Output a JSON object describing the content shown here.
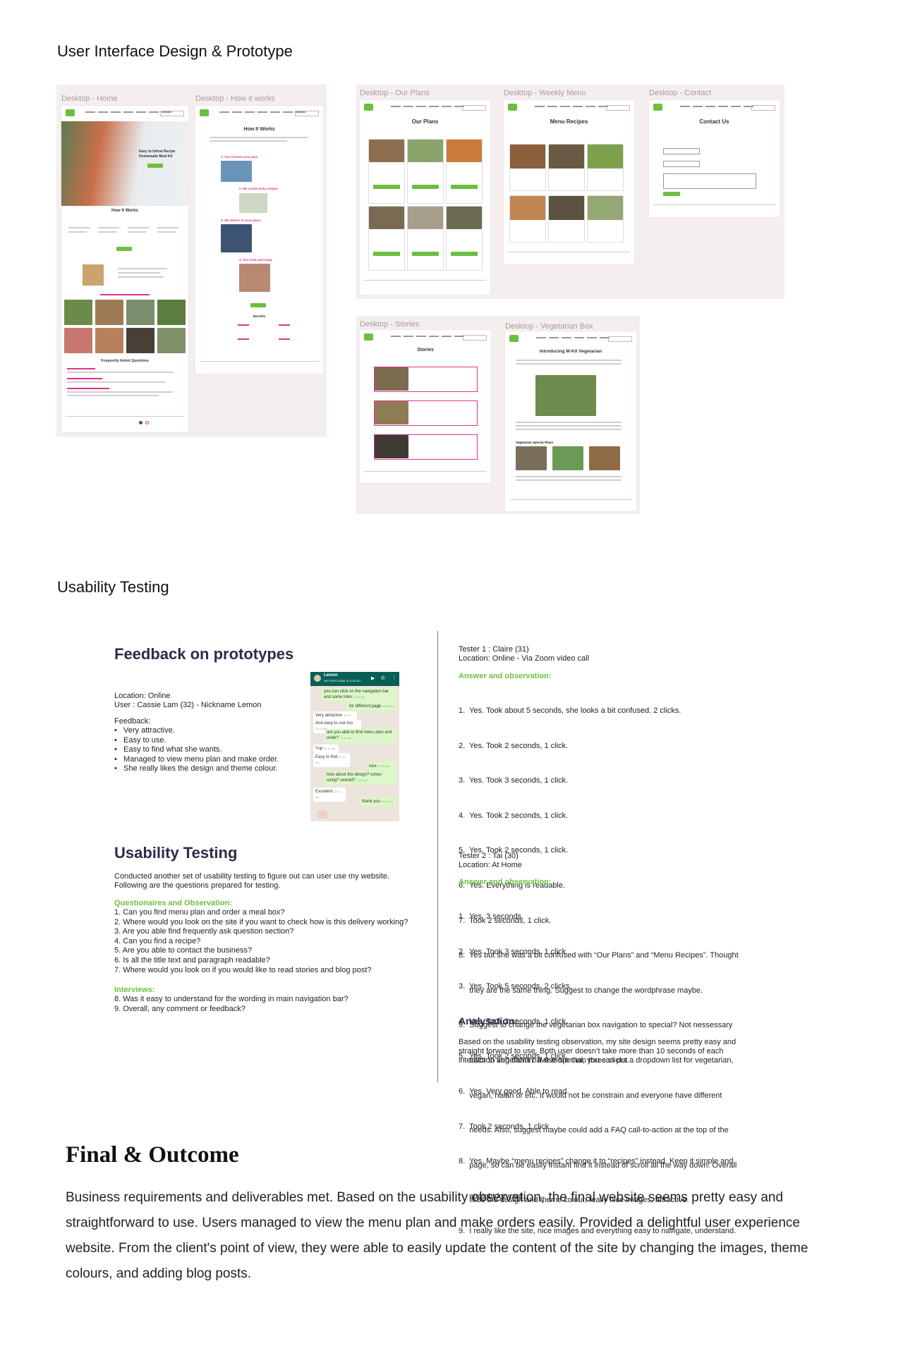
{
  "sections": {
    "ui_design_title": "User Interface Design & Prototype",
    "usability_title": "Usability Testing",
    "final_title": "Final & Outcome",
    "final_text": "Business requirements and deliverables met. Based on the usability observation, the final website seems pretty easy and straightforward to use. Users managed to view the menu plan and make orders easily. Provided a delightful user experience website. From the client's point of view, they were able to easily update the content of the site by changing the images, theme colours, and adding blog posts."
  },
  "frames": {
    "home": "Desktop - Home",
    "how": "Desktop - How it works",
    "plans": "Desktop - Our Plans",
    "weekly": "Desktop - Weekly Menu",
    "contact": "Desktop - Contact",
    "stories": "Desktop - Stories",
    "veg": "Desktop - Vegetarian Box"
  },
  "mockups": {
    "home_hero": "Easy to follow Recipe Homemade Meal Kit",
    "home_how": "How It Works",
    "home_faq": "Frequently Asked Questions",
    "how_title": "How It Works",
    "how_steps": [
      "1. You Choose your plan",
      "2. We create tasty recipes",
      "3. We deliver to your place",
      "4. You cook and enjoy"
    ],
    "how_benefits": "Benefits",
    "plans_title": "Our Plans",
    "menu_title": "Menu Recipes",
    "contact_title": "Contact Us",
    "stories_title": "Stories",
    "veg_title": "Introducing M-Kit Vegetarian",
    "veg_special": "Vegetarian Special Plans"
  },
  "feedback": {
    "title": "Feedback on prototypes",
    "location": "Location: Online",
    "user": "User : Cassie Lam (32) - Nickname Lemon",
    "feedback_label": "Feedback:",
    "items": [
      "Very attractive.",
      "Easy to use.",
      "Easy to find what she wants.",
      "Managed to view menu plan and make order.",
      "She really likes the design and theme colour."
    ]
  },
  "chat": {
    "name": "Lemon",
    "status": "last seen today at 2:29 am",
    "messages": [
      {
        "text": "you can click on the navigation bar and some links",
        "time": "12:09 am",
        "side": "right"
      },
      {
        "text": "for different page",
        "time": "12:09 am",
        "side": "right"
      },
      {
        "text": "Very attractive",
        "time": "12:10 am",
        "side": "left"
      },
      {
        "text": "And easy to use too",
        "time": "12:10 am",
        "side": "left"
      },
      {
        "text": "are you able to find menu plan and order?",
        "time": "12:11 am",
        "side": "right"
      },
      {
        "text": "Yup",
        "time": "12:11 am",
        "side": "left"
      },
      {
        "text": "Easy to find",
        "time": "12:12 am",
        "side": "left"
      },
      {
        "text": "nice",
        "time": "12:12 am",
        "side": "right"
      },
      {
        "text": "how about the design? colour using? overall?",
        "time": "12:13 am",
        "side": "right"
      },
      {
        "text": "Excellent",
        "time": "12:14 am",
        "side": "left"
      },
      {
        "text": "thank you",
        "time": "12:14 am",
        "side": "right"
      }
    ]
  },
  "usability": {
    "title": "Usability Testing",
    "intro1": "Conducted another set of usability testing to figure out can user use my website.",
    "intro2": "Following are the questions prepared for testing.",
    "questions_label": "Questionaires and Observation:",
    "questions": [
      "1.  Can you find menu plan and order a meal box?",
      "2.  Where would you look on the site if you want to check how is this delivery working?",
      "3.  Are you able find frequently ask question section?",
      "4.  Can you find a recipe?",
      "5.  Are you able to contact the business?",
      "6.  Is all the title text and paragraph readable?",
      "7.  Where would you look on if you would like to read stories and blog post?"
    ],
    "interviews_label": "Interviews:",
    "interviews": [
      "8.  Was it easy to understand for the wording in main navigation bar?",
      "9.  Overall, any comment or feedback?"
    ]
  },
  "tester1": {
    "name": "Tester 1 : Claire (31)",
    "location": "Location: Online - Via Zoom video call",
    "label": "Answer and observation:",
    "answers": [
      "1.  Yes. Took about 5 seconds, she looks a bit confused. 2 clicks.",
      "2.  Yes. Took 2 seconds, 1 click.",
      "3.  Yes. Took 3 seconds, 1 click.",
      "4.  Yes. Took 2 seconds, 1 click.",
      "5.  Yes. Took 2 seconds, 1 click.",
      "6.  Yes. Everything is readable.",
      "7.  Took 2 seconds, 1 click.",
      "8.  Yes but she was a bit confused with “Our Plans” and “Menu Recipes”. Thought",
      "     they are the same thing. Suggest to change the wordphrase maybe.",
      "9.  Suggest to change the vegetarian box navigation to special? Not nessessary",
      "     tailor to vegetarian. If use special, you can put a dropdown list for vegetarian,",
      "     vegan, halah or etc. It would not be constrain and everyone have different",
      "     needs. Also, suggest maybe could add a FAQ call-to-action at the top of the",
      "     page, so can be easily instant find it instead of scroll all the way down. Overall",
      "     likes the design and theme colour, really nice images, attractive."
    ]
  },
  "tester2": {
    "name": "Tester 2 : Tai (30)",
    "location": "Location: At Home",
    "label": "Answer and observation:",
    "answers": [
      "1.  Yes. 3 seconds.",
      "2.  Yes. Took 3 seconds, 1 click.",
      "3.  Yes. Took 5 seconds, 2 clicks.",
      "4.  Yes. Took 2 seconds, 1 click.",
      "5.  Yes. Took 2 seconds, 1 click.",
      "6.  Yes. Very good. Able to read.",
      "7.  Took 2 seconds, 1 click.",
      "8.  Yes. Maybe “menu recipes” change it to “recipes” instead. Keep it simple and",
      "     straight forward.",
      "9.  I really like the site, nice images and everything easy to navigate, understand."
    ]
  },
  "analysation": {
    "title": "Analysation:",
    "text1": "Based on the usability testing observation, my site design seems pretty easy and",
    "text2": "straight forward to use. Both user doesn’t take more than 10 seconds of each",
    "text3": "interaction and didn’t have more than three clicks."
  },
  "colors": {
    "accent_green": "#6cbf3f",
    "accent_pink": "#e0338a",
    "heading_navy": "#2f2b4a",
    "board_bg": "#f5eeee"
  }
}
